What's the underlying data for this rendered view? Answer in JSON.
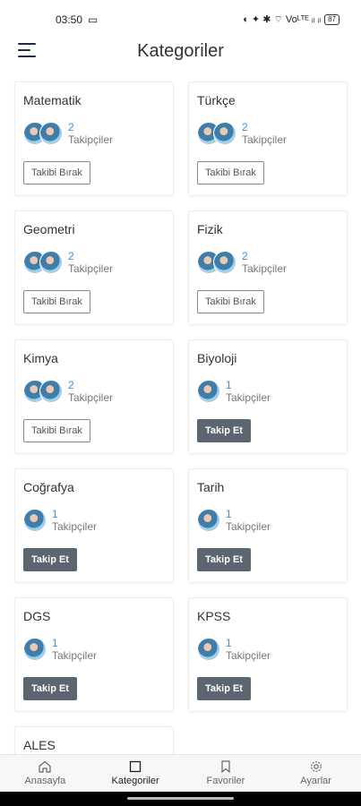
{
  "status": {
    "time": "03:50",
    "right_text": "◐ ✦ ✱ ⌔ Voᴸᵀᴱ ᵢₗ ᵢₗ",
    "battery": "87"
  },
  "header": {
    "title": "Kategoriler"
  },
  "categories": [
    {
      "name": "Matematik",
      "count": "2",
      "label": "Takipçiler",
      "button": "Takibi Bırak"
    },
    {
      "name": "Türkçe",
      "count": "2",
      "label": "Takipçiler",
      "button": "Takibi Bırak"
    },
    {
      "name": "Geometri",
      "count": "2",
      "label": "Takipçiler",
      "button": "Takibi Bırak"
    },
    {
      "name": "Fizik",
      "count": "2",
      "label": "Takipçiler",
      "button": "Takibi Bırak"
    },
    {
      "name": "Kimya",
      "count": "2",
      "label": "Takipçiler",
      "button": "Takibi Bırak"
    },
    {
      "name": "Biyoloji",
      "count": "1",
      "label": "Takipçiler",
      "button": "Takip Et"
    },
    {
      "name": "Coğrafya",
      "count": "1",
      "label": "Takipçiler",
      "button": "Takip Et"
    },
    {
      "name": "Tarih",
      "count": "1",
      "label": "Takipçiler",
      "button": "Takip Et"
    },
    {
      "name": "DGS",
      "count": "1",
      "label": "Takipçiler",
      "button": "Takip Et"
    },
    {
      "name": "KPSS",
      "count": "1",
      "label": "Takipçiler",
      "button": "Takip Et"
    },
    {
      "name": "ALES"
    }
  ],
  "bottom_nav": [
    {
      "label": "Anasayfa",
      "icon": "home-icon"
    },
    {
      "label": "Kategoriler",
      "icon": "square-icon"
    },
    {
      "label": "Favoriler",
      "icon": "bookmark-icon"
    },
    {
      "label": "Ayarlar",
      "icon": "gear-icon"
    }
  ],
  "colors": {
    "accent": "#3f8fd6",
    "button_filled": "#5d6670",
    "title": "#333333"
  }
}
